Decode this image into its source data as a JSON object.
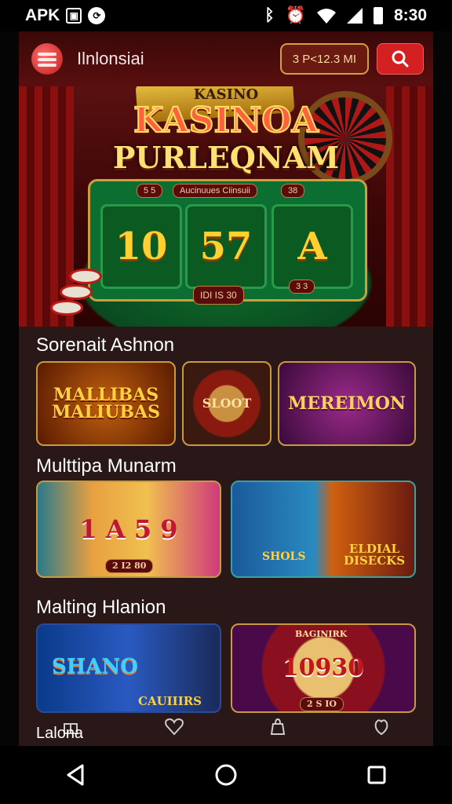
{
  "status_bar": {
    "left_text": "APK",
    "badge_icon": "image-icon",
    "round_icon": "link-icon",
    "time": "8:30"
  },
  "header": {
    "title": "Ilnlonsiai",
    "balance": "3 P<12.3 MI",
    "search_icon": "search-icon"
  },
  "hero": {
    "tag": "KASINO",
    "title_line1": "KASINOA",
    "title_line2": "PURLEQNAM",
    "pill_left": "5 5",
    "pill_center": "Aucinuues Ciinsuii",
    "pill_right": "38",
    "slots": [
      "10",
      "57",
      "A"
    ],
    "bottom_button": "IDI IS 30",
    "small_pill": "3 3"
  },
  "sections": [
    {
      "title": "Sorenait Ashnon",
      "cards": [
        {
          "label": "MALLIBAS\nMALIUBAS"
        },
        {
          "label": "SLOOT"
        },
        {
          "label": "MEREIMON"
        }
      ]
    },
    {
      "title": "Multtipa Munarm",
      "cards": [
        {
          "label": "1 A 5 9",
          "tag": "2 I2 80"
        },
        {
          "label": "SHOLS",
          "label2": "ELDIAL DISECKS"
        }
      ]
    },
    {
      "title": "Malting Hlanion",
      "cards": [
        {
          "label": "SHANO",
          "label2": "CAUIIIRS"
        },
        {
          "label": "10930",
          "tag": "2 S IO",
          "top": "BAGINIRK"
        }
      ]
    }
  ],
  "bottom_nav": {
    "label": "Lalona",
    "icons": [
      "gift-icon",
      "heart-icon",
      "bag-icon",
      "wallet-icon"
    ]
  },
  "android_nav": [
    "back-icon",
    "home-icon",
    "recents-icon"
  ],
  "colors": {
    "accent_red": "#d42020",
    "gold": "#d4a040",
    "felt_green": "#0d6e32"
  }
}
